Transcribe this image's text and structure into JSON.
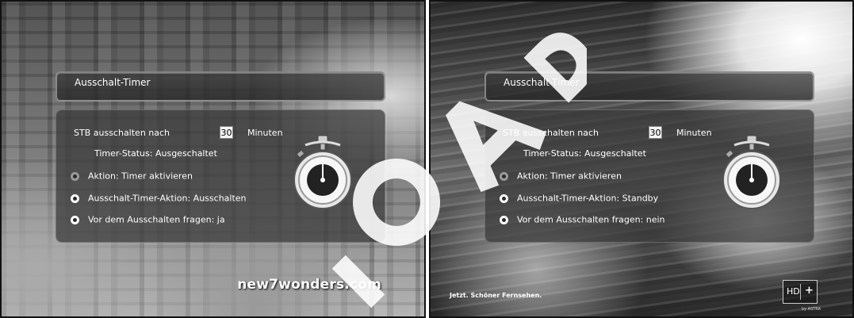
{
  "screens": [
    {
      "title": "Ausschalt-Timer",
      "stb_label": "STB ausschalten nach",
      "minutes_value": "30",
      "minutes_unit": "Minuten",
      "timer_status": "Timer-Status: Ausgeschaltet",
      "options": [
        {
          "label": "Aktion: Timer aktivieren",
          "state": "inactive"
        },
        {
          "label": "Ausschalt-Timer-Aktion: Ausschalten",
          "state": "active"
        },
        {
          "label": "Vor dem Ausschalten fragen: ja",
          "state": "active"
        }
      ],
      "overlay_text": "new7wonders.com"
    },
    {
      "title": "Ausschalt-Timer",
      "stb_label": "STB ausschalten nach",
      "minutes_value": "30",
      "minutes_unit": "Minuten",
      "timer_status": "Timer-Status: Ausgeschaltet",
      "options": [
        {
          "label": "Aktion: Timer aktivieren",
          "state": "inactive"
        },
        {
          "label": "Ausschalt-Timer-Aktion: Standby",
          "state": "active"
        },
        {
          "label": "Vor dem Ausschalten fragen: nein",
          "state": "active"
        }
      ],
      "slogan": "Jetzt. Schöner Fernsehen.",
      "hd_logo": {
        "hd": "HD",
        "plus": "+",
        "sub": "by ASTRA"
      }
    }
  ],
  "icons": [
    "stopwatch-icon",
    "radio-icon"
  ]
}
